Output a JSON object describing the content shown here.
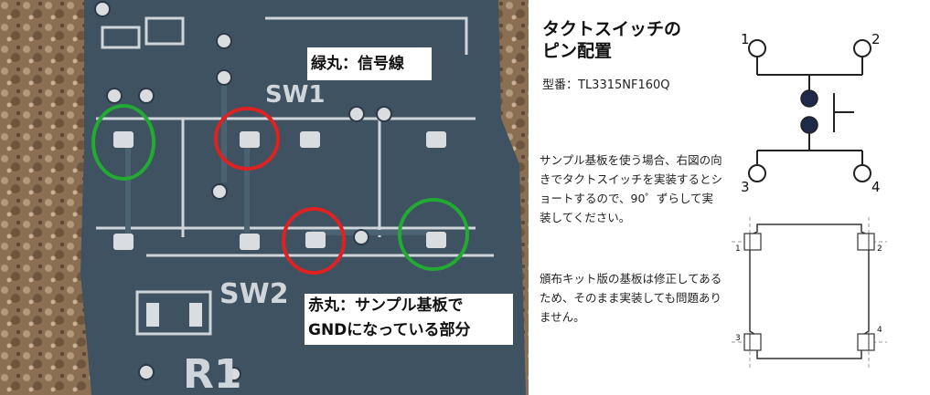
{
  "photo": {
    "silkscreen": {
      "sw1": "SW1",
      "sw2": "SW2",
      "r1": "R1"
    },
    "green_label": "緑丸：信号線",
    "red_label_line1": "赤丸：サンプル基板で",
    "red_label_line2": "GNDになっている部分",
    "colors": {
      "board": "#3f5262",
      "green_circle": "#22aa33",
      "red_circle": "#dd2222",
      "pad": "#d9dde0"
    }
  },
  "info": {
    "title_line1": "タクトスイッチの",
    "title_line2": "ピン配置",
    "model": "型番：TL3315NF160Q",
    "note1": "サンプル基板を使う場合、右図の向きでタクトスイッチを実装するとショートするので、90゜ずらして実装してください。",
    "note2": "頒布キット版の基板は修正してあるため、そのまま実装しても問題ありません。"
  },
  "schematic": {
    "pin_labels": [
      "1",
      "2",
      "3",
      "4"
    ]
  },
  "footprint": {
    "pin_labels": [
      "1",
      "2",
      "3",
      "4"
    ]
  }
}
